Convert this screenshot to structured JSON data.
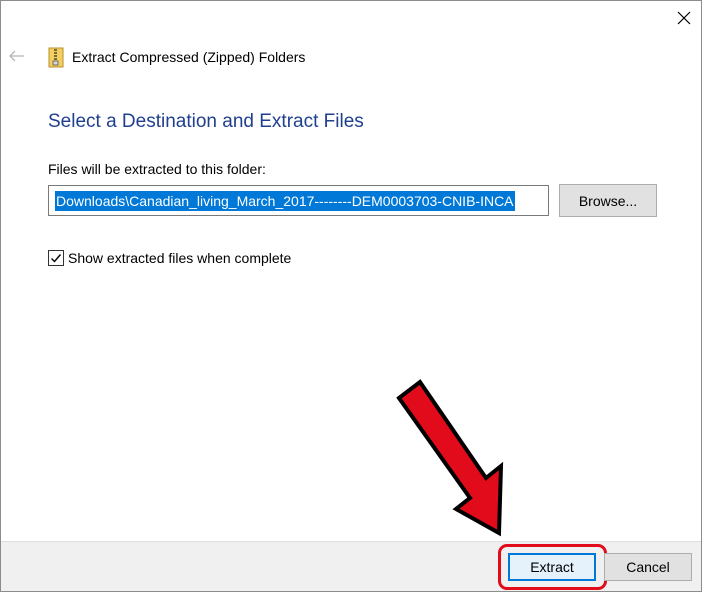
{
  "window": {
    "title": "Extract Compressed (Zipped) Folders",
    "close_icon": "close-icon",
    "back_icon": "back-arrow-icon",
    "title_icon": "zip-folder-icon"
  },
  "main": {
    "heading": "Select a Destination and Extract Files",
    "folder_label": "Files will be extracted to this folder:",
    "path_value": "Downloads\\Canadian_living_March_2017--------DEM0003703-CNIB-INCA",
    "browse_label": "Browse...",
    "show_files_checked": true,
    "show_files_label": "Show extracted files when complete"
  },
  "footer": {
    "extract_label": "Extract",
    "cancel_label": "Cancel"
  },
  "annotation": {
    "arrow_icon": "red-arrow-icon",
    "color": "#e10b1b"
  },
  "colors": {
    "heading": "#1f3f8f",
    "selection": "#0078d7",
    "footer_bg": "#f0f0f0"
  }
}
